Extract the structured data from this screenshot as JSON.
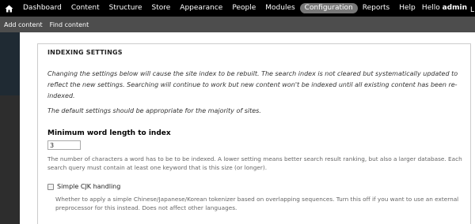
{
  "toolbar": {
    "items": [
      {
        "label": "Dashboard"
      },
      {
        "label": "Content"
      },
      {
        "label": "Structure"
      },
      {
        "label": "Store"
      },
      {
        "label": "Appearance"
      },
      {
        "label": "People"
      },
      {
        "label": "Modules"
      },
      {
        "label": "Configuration",
        "active": true
      },
      {
        "label": "Reports"
      },
      {
        "label": "Help"
      }
    ],
    "hello_prefix": "Hello",
    "username": "admin",
    "cut_text": "L"
  },
  "shortcuts": {
    "items": [
      {
        "label": "Add content"
      },
      {
        "label": "Find content"
      }
    ]
  },
  "indexing": {
    "legend": "INDEXING SETTINGS",
    "description": "Changing the settings below will cause the site index to be rebuilt. The search index is not cleared but systematically updated to reflect the new settings. Searching will continue to work but new content won't be indexed until all existing content has been re-indexed.",
    "default_note": "The default settings should be appropriate for the majority of sites.",
    "min_word_length": {
      "label": "Minimum word length to index",
      "value": "3",
      "description": "The number of characters a word has to be to be indexed. A lower setting means better search result ranking, but also a larger database. Each search query must contain at least one keyword that is this size (or longer)."
    },
    "cjk": {
      "label": "Simple CJK handling",
      "checked": false,
      "description": "Whether to apply a simple Chinese/Japanese/Korean tokenizer based on overlapping sequences. Turn this off if you want to use an external preprocessor for this instead. Does not affect other languages."
    }
  },
  "colors": {
    "toolbar_bg": "#000000",
    "active_pill": "#777777",
    "shortcut_bar": "#4d4d4d"
  },
  "icons": {
    "home": "home-icon"
  }
}
